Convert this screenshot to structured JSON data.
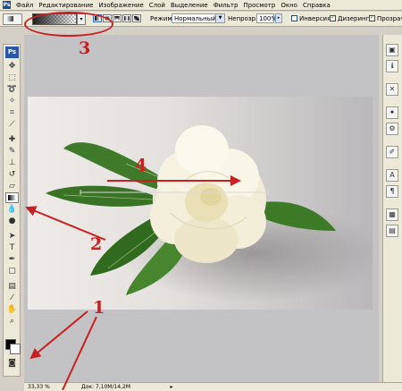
{
  "menu": {
    "items": [
      "Файл",
      "Редактирование",
      "Изображение",
      "Слой",
      "Выделение",
      "Фильтр",
      "Просмотр",
      "Окно",
      "Справка"
    ]
  },
  "options": {
    "mode_label": "Режим:",
    "mode_value": "Нормальный",
    "opacity_label": "Непрозр.:",
    "opacity_value": "100%",
    "inverse_label": "Инверсия",
    "dither_label": "Дизеринг",
    "transparency_label": "Прозрачность",
    "inverse_checked": false,
    "dither_checked": true,
    "transparency_checked": true
  },
  "toolbox": {
    "logo": "Ps"
  },
  "status": {
    "zoom": "33,33 %",
    "doc_info": "Док: 7,10M/14,2M"
  },
  "annotations": {
    "n1": "1",
    "n2": "2",
    "n3": "3",
    "n4": "4"
  },
  "icons": {
    "tools": [
      "move-icon",
      "marquee-icon",
      "lasso-icon",
      "magic-wand-icon",
      "crop-icon",
      "slice-icon",
      "healing-brush-icon",
      "brush-icon",
      "clone-stamp-icon",
      "history-brush-icon",
      "eraser-icon",
      "gradient-icon",
      "blur-icon",
      "dodge-icon",
      "path-selection-icon",
      "type-icon",
      "pen-icon",
      "shape-icon",
      "notes-icon",
      "eyedropper-icon",
      "hand-icon",
      "zoom-icon",
      "quick-mask-icon"
    ],
    "panels": [
      "navigator-icon",
      "info-icon",
      "histogram-icon",
      "brushes-icon",
      "tool-presets-icon",
      "layer-comps-icon",
      "character-icon",
      "paragraph-icon",
      "swatches-icon",
      "styles-icon"
    ]
  },
  "colors": {
    "annotation": "#c82020",
    "foreground": "#000000",
    "background": "#ffffff",
    "leaf": "#3f7a2a",
    "petal": "#f7f2df"
  }
}
